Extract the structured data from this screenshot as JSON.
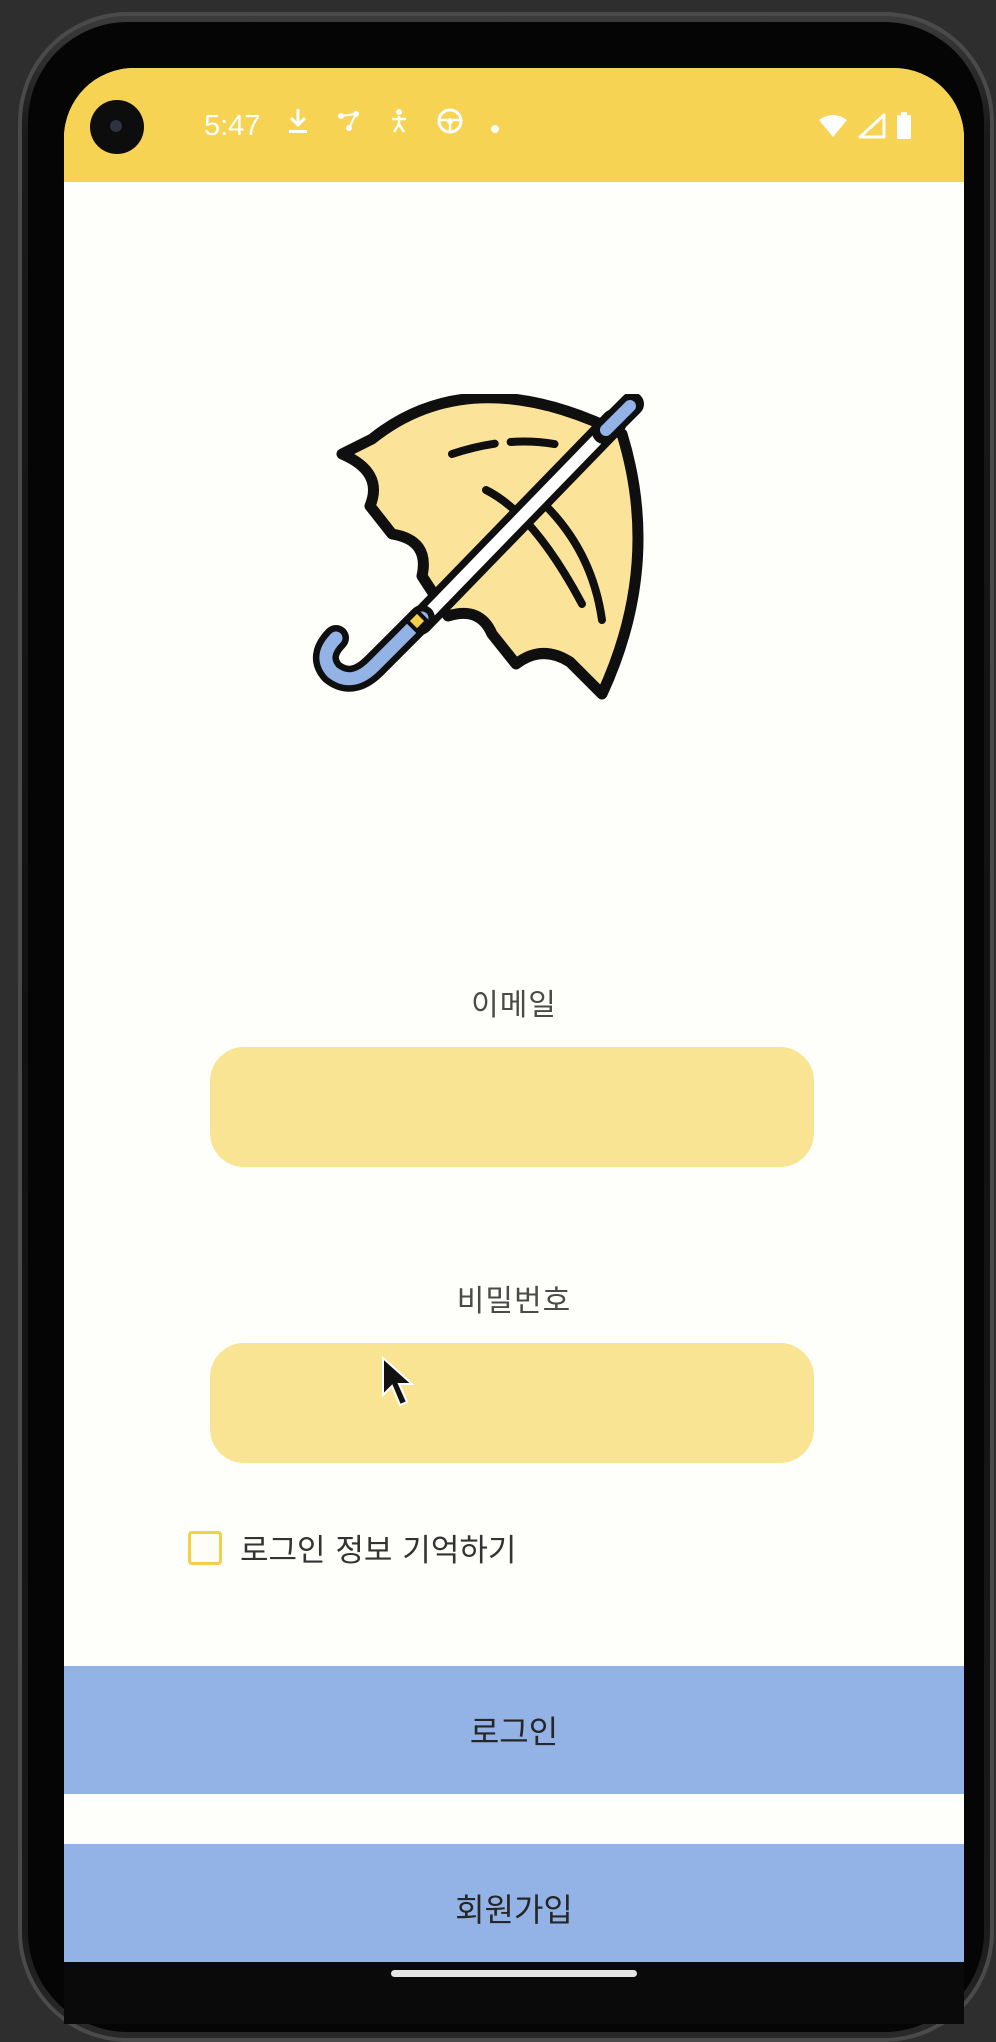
{
  "status_bar": {
    "time": "5:47",
    "left_icons": [
      "download-icon",
      "network-icon",
      "accessibility-icon",
      "steering-icon",
      "dot-icon"
    ],
    "right_icons": [
      "wifi-icon",
      "signal-icon",
      "battery-icon"
    ],
    "background_color": "#f6d353"
  },
  "logo": {
    "icon": "umbrella-icon",
    "canopy_color": "#fbe49a",
    "handle_color": "#93b2e6"
  },
  "form": {
    "email_label": "이메일",
    "email_value": "",
    "password_label": "비밀번호",
    "password_value": "",
    "remember_label": "로그인 정보 기억하기",
    "remember_checked": false,
    "field_color": "#f9e494"
  },
  "buttons": {
    "login_label": "로그인",
    "signup_label": "회원가입",
    "color": "#93b2e6"
  }
}
